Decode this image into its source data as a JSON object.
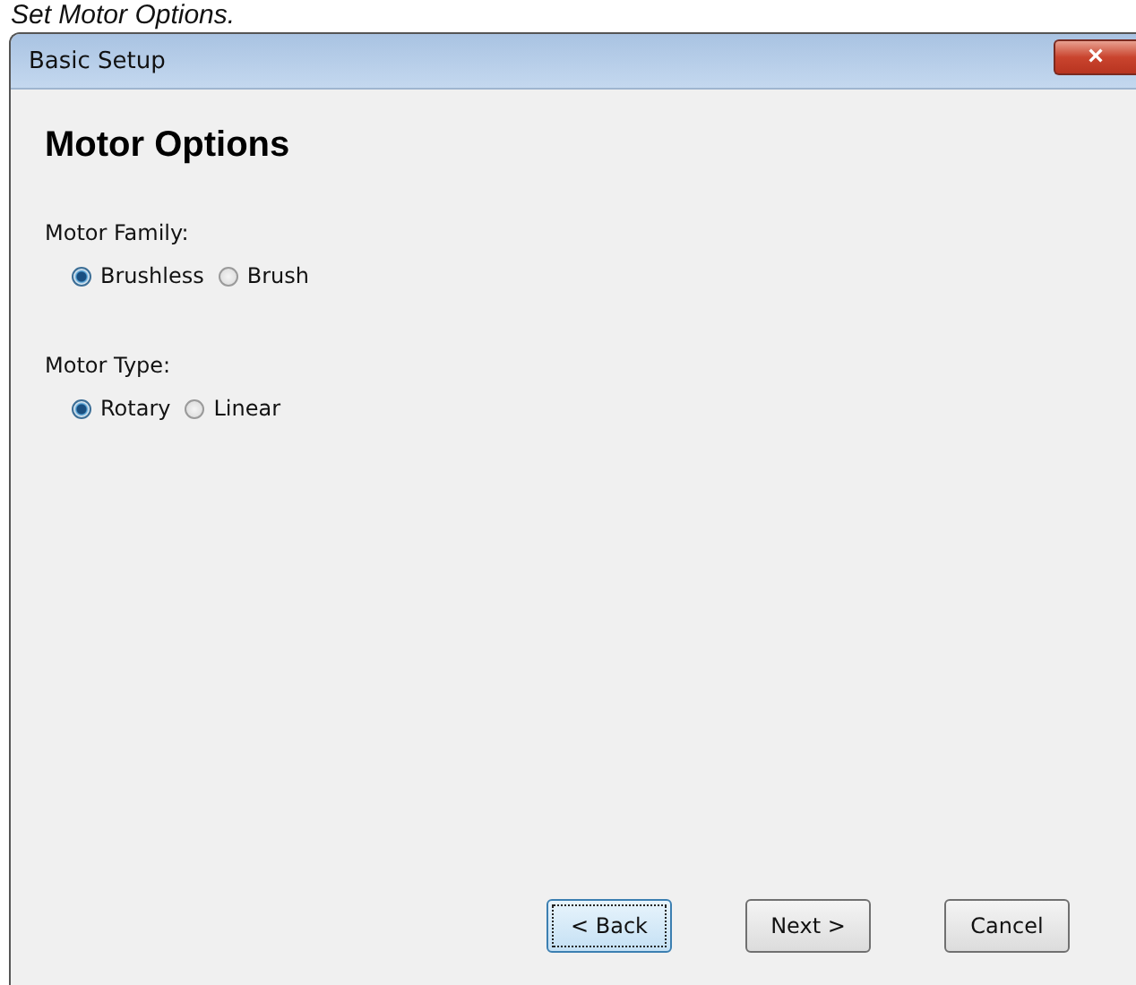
{
  "caption": "Set Motor Options.",
  "window": {
    "title": "Basic Setup",
    "close_label": "×"
  },
  "heading": "Motor Options",
  "groups": [
    {
      "label": "Motor Family:",
      "options": [
        {
          "label": "Brushless",
          "selected": true
        },
        {
          "label": "Brush",
          "selected": false
        }
      ]
    },
    {
      "label": "Motor Type:",
      "options": [
        {
          "label": "Rotary",
          "selected": true
        },
        {
          "label": "Linear",
          "selected": false
        }
      ]
    }
  ],
  "buttons": [
    {
      "label": "< Back",
      "focused": true
    },
    {
      "label": "Next >",
      "focused": false
    },
    {
      "label": "Cancel",
      "focused": false
    }
  ]
}
